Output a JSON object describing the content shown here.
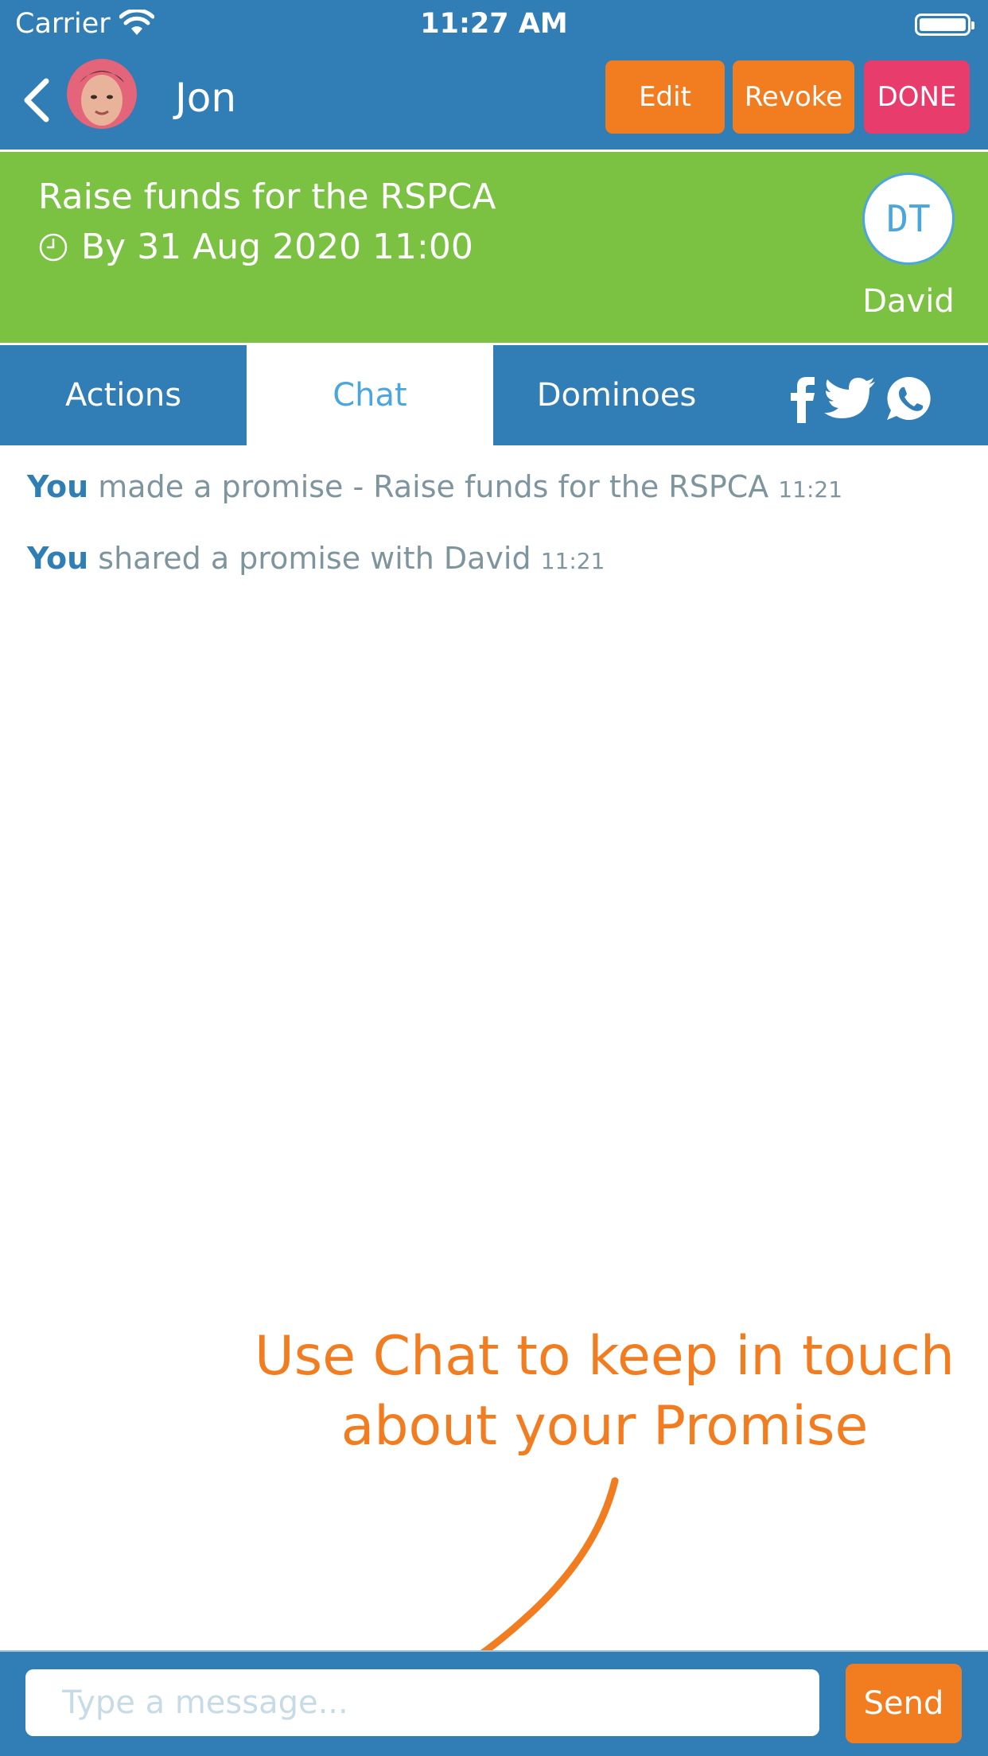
{
  "status_bar": {
    "carrier": "Carrier",
    "time": "11:27 AM"
  },
  "nav": {
    "title": "Jon",
    "buttons": {
      "edit": "Edit",
      "revoke": "Revoke",
      "done": "DONE"
    }
  },
  "promise": {
    "title": "Raise funds for the RSPCA",
    "deadline": "By 31 Aug 2020 11:00",
    "partner_initials": "DT",
    "partner_name": "David"
  },
  "tabs": [
    {
      "label": "Actions",
      "active": false
    },
    {
      "label": "Chat",
      "active": true
    },
    {
      "label": "Dominoes",
      "active": false
    }
  ],
  "social_icons": [
    "facebook-icon",
    "twitter-icon",
    "whatsapp-icon"
  ],
  "messages": [
    {
      "who": "You",
      "text": "made a promise - Raise funds for the RSPCA",
      "time": "11:21"
    },
    {
      "who": "You",
      "text": "shared a promise with David",
      "time": "11:21"
    }
  ],
  "annotation": {
    "line1": "Use Chat to keep in touch",
    "line2": "about your Promise"
  },
  "composer": {
    "placeholder": "Type a message...",
    "value": "",
    "send_label": "Send"
  },
  "colors": {
    "primary": "#317db5",
    "banner": "#7bc142",
    "accent_orange": "#f27d21",
    "done_pink": "#e73c6c",
    "chat_blue": "#4aa6dd"
  }
}
